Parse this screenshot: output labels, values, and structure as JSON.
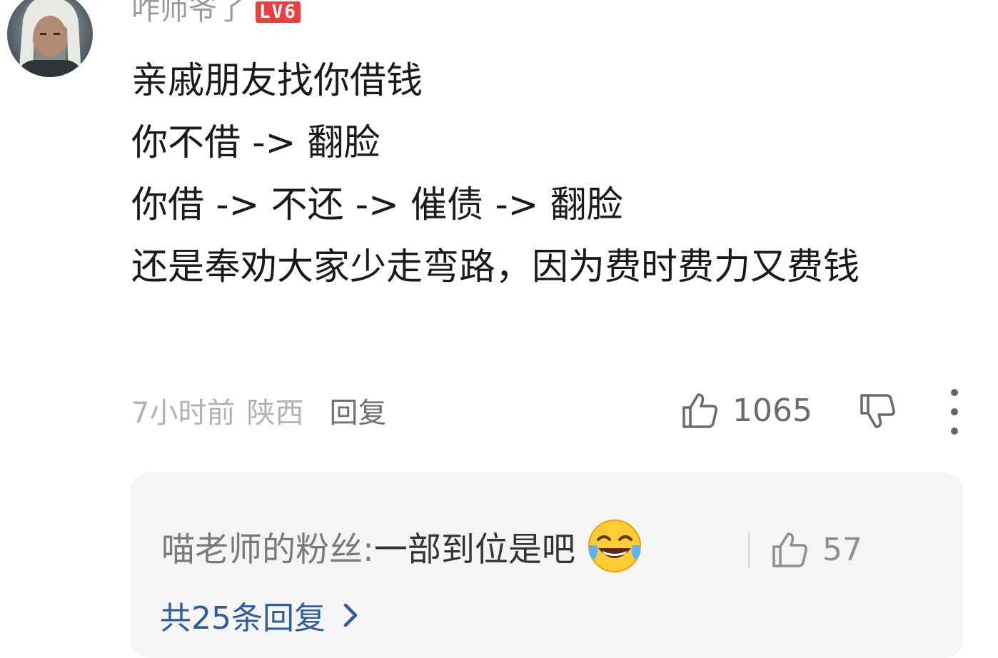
{
  "comment": {
    "username": "咋师爷了",
    "level": "LV6",
    "avatar_icon": "witcher-avatar",
    "body_lines": [
      "亲戚朋友找你借钱",
      "你不借 -> 翻脸",
      "你借 -> 不还 -> 催债 -> 翻脸",
      "还是奉劝大家少走弯路，因为费时费力又费钱"
    ],
    "time": "7小时前",
    "region": "陕西",
    "reply_label": "回复",
    "likes": "1065"
  },
  "replies": {
    "top_reply": {
      "author": "喵老师的粉丝:",
      "text": " 一部到位是吧",
      "emoji": "tears-of-joy-emoji",
      "likes": "57"
    },
    "view_all_label": "共25条回复"
  },
  "colors": {
    "level_badge": "#e9413f",
    "link_blue": "#2f5d99",
    "reply_box_bg": "#f5f5f6"
  }
}
